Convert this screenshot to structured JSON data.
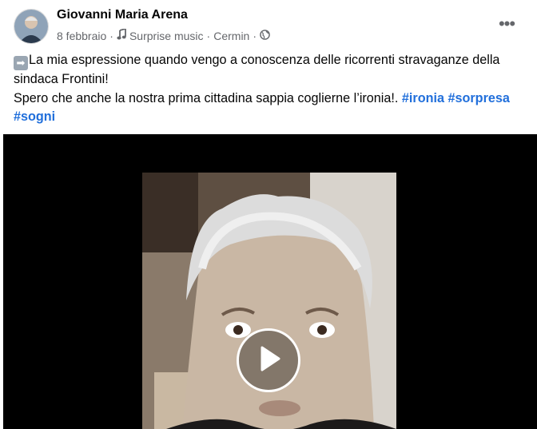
{
  "post": {
    "author": "Giovanni Maria Arena",
    "date": "8 febbraio",
    "separator": "·",
    "music_label": "Surprise music",
    "location": "Cermin",
    "text_line1": "La mia espressione quando vengo a conoscenza delle ricorrenti stravaganze della sindaca Frontini!",
    "text_line2": "Spero che anche la nostra prima cittadina sappia coglierne l’ironia!.",
    "hashtags": [
      "#ironia",
      "#sorpresa",
      "#sogni"
    ],
    "more_label": "•••"
  },
  "icons": {
    "arrow": "right-arrow-emoji-icon",
    "music": "music-note-icon",
    "audience": "globe-icon",
    "play": "play-icon"
  },
  "colors": {
    "link": "#216fdb",
    "meta": "#65676b",
    "video_bg": "#000000"
  }
}
